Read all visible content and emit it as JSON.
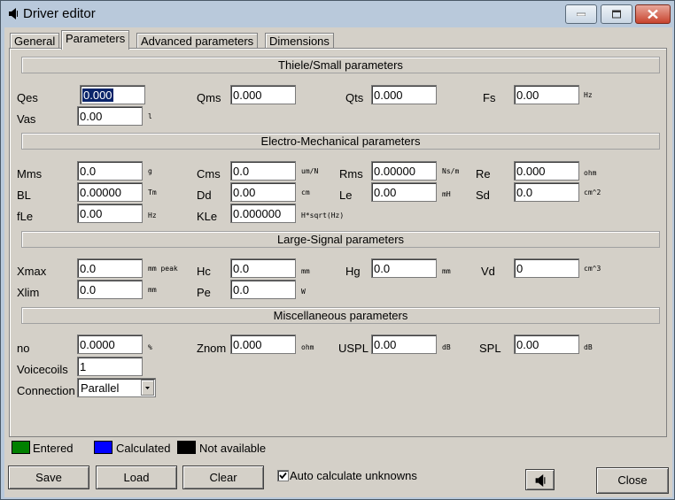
{
  "window": {
    "title": "Driver editor",
    "icon": "speaker-icon"
  },
  "tabs": [
    {
      "label": "General"
    },
    {
      "label": "Parameters"
    },
    {
      "label": "Advanced parameters"
    },
    {
      "label": "Dimensions"
    }
  ],
  "sections": {
    "thiele": "Thiele/Small parameters",
    "electro": "Electro-Mechanical parameters",
    "large": "Large-Signal parameters",
    "misc": "Miscellaneous parameters"
  },
  "params": {
    "qes": {
      "label": "Qes",
      "value": "0.000"
    },
    "qms": {
      "label": "Qms",
      "value": "0.000"
    },
    "qts": {
      "label": "Qts",
      "value": "0.000"
    },
    "fs": {
      "label": "Fs",
      "value": "0.00",
      "unit": "Hz"
    },
    "vas": {
      "label": "Vas",
      "value": "0.00",
      "unit": "l"
    },
    "mms": {
      "label": "Mms",
      "value": "0.0",
      "unit": "g"
    },
    "cms": {
      "label": "Cms",
      "value": "0.0",
      "unit": "um/N"
    },
    "rms": {
      "label": "Rms",
      "value": "0.00000",
      "unit": "Ns/m"
    },
    "re": {
      "label": "Re",
      "value": "0.000",
      "unit": "ohm"
    },
    "bl": {
      "label": "BL",
      "value": "0.00000",
      "unit": "Tm"
    },
    "dd": {
      "label": "Dd",
      "value": "0.00",
      "unit": "cm"
    },
    "le": {
      "label": "Le",
      "value": "0.00",
      "unit": "mH"
    },
    "sd": {
      "label": "Sd",
      "value": "0.0",
      "unit": "cm^2"
    },
    "fle": {
      "label": "fLe",
      "value": "0.00",
      "unit": "Hz"
    },
    "kle": {
      "label": "KLe",
      "value": "0.000000",
      "unit": "H*sqrt(Hz)"
    },
    "xmax": {
      "label": "Xmax",
      "value": "0.0",
      "unit": "mm peak"
    },
    "hc": {
      "label": "Hc",
      "value": "0.0",
      "unit": "mm"
    },
    "hg": {
      "label": "Hg",
      "value": "0.0",
      "unit": "mm"
    },
    "vd": {
      "label": "Vd",
      "value": "0",
      "unit": "cm^3"
    },
    "xlim": {
      "label": "Xlim",
      "value": "0.0",
      "unit": "mm"
    },
    "pe": {
      "label": "Pe",
      "value": "0.0",
      "unit": "W"
    },
    "no": {
      "label": "no",
      "value": "0.0000",
      "unit": "%"
    },
    "znom": {
      "label": "Znom",
      "value": "0.000",
      "unit": "ohm"
    },
    "uspl": {
      "label": "USPL",
      "value": "0.00",
      "unit": "dB"
    },
    "spl": {
      "label": "SPL",
      "value": "0.00",
      "unit": "dB"
    },
    "voicecoils": {
      "label": "Voicecoils",
      "value": "1"
    },
    "connection": {
      "label": "Connection",
      "value": "Parallel"
    }
  },
  "legend": [
    {
      "label": "Entered",
      "color": "#008000"
    },
    {
      "label": "Calculated",
      "color": "#0000ff"
    },
    {
      "label": "Not available",
      "color": "#000000"
    }
  ],
  "buttons": {
    "save": "Save",
    "load": "Load",
    "clear": "Clear",
    "close": "Close"
  },
  "auto_calc": {
    "label": "Auto calculate unknowns",
    "checked": true
  }
}
